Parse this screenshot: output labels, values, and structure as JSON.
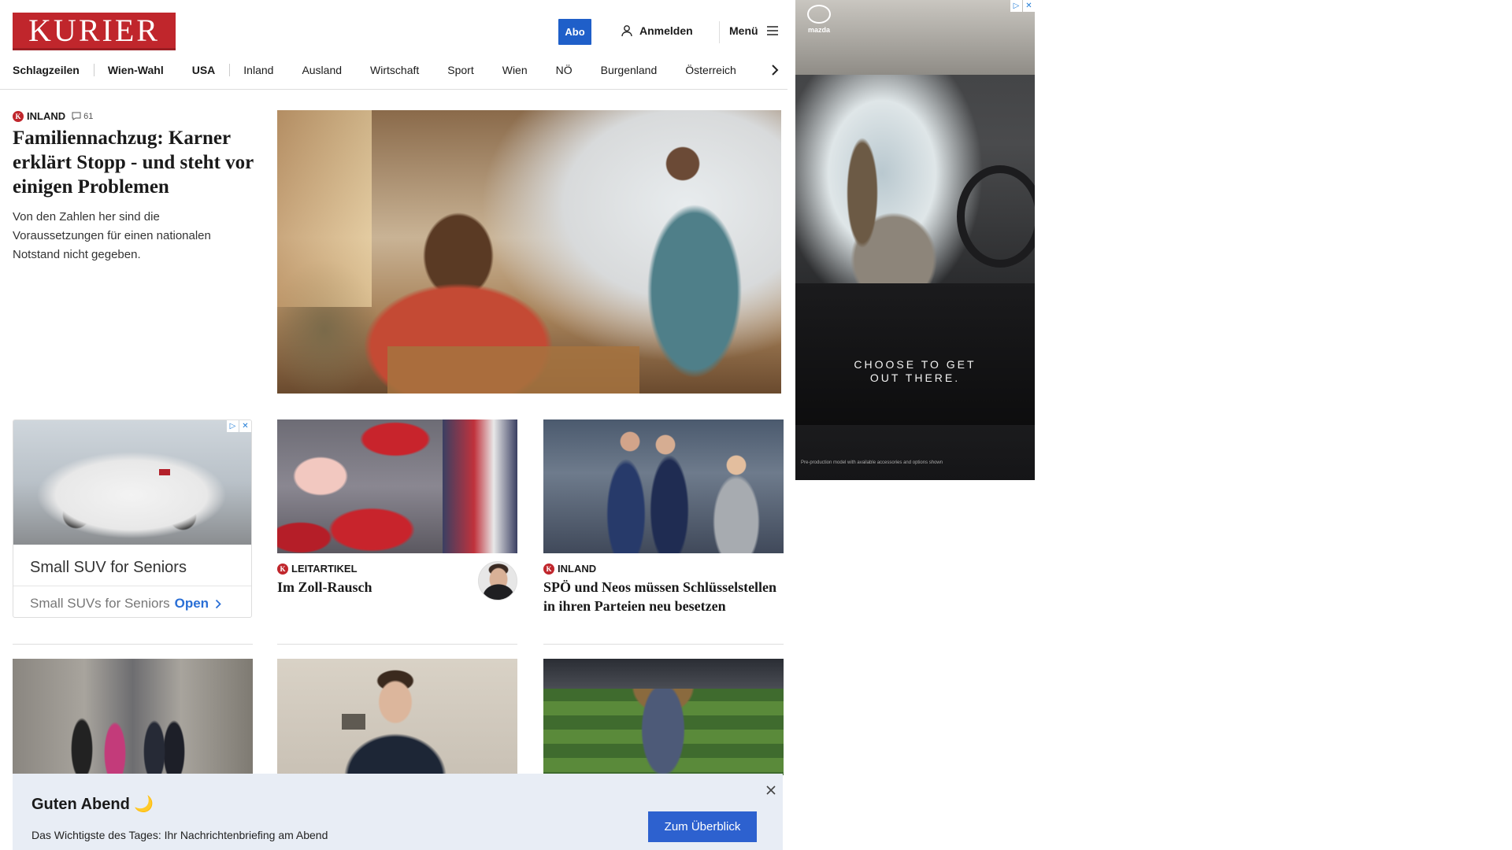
{
  "header": {
    "logo": "KURIER",
    "abo": "Abo",
    "login": "Anmelden",
    "menu": "Menü"
  },
  "nav": [
    {
      "label": "Schlagzeilen",
      "bold": true
    },
    {
      "label": "Wien-Wahl",
      "bold": true
    },
    {
      "label": "USA",
      "bold": true
    },
    {
      "label": "Inland",
      "bold": false
    },
    {
      "label": "Ausland",
      "bold": false
    },
    {
      "label": "Wirtschaft",
      "bold": false
    },
    {
      "label": "Sport",
      "bold": false
    },
    {
      "label": "Wien",
      "bold": false
    },
    {
      "label": "NÖ",
      "bold": false
    },
    {
      "label": "Burgenland",
      "bold": false
    },
    {
      "label": "Österreich",
      "bold": false
    }
  ],
  "lead": {
    "kicker": "INLAND",
    "comments": "61",
    "title": "Familiennachzug: Karner erklärt Stopp - und steht vor einigen Problemen",
    "teaser": "Von den Zahlen her sind die Voraussetzungen für einen nationalen Notstand nicht gegeben."
  },
  "ad_card": {
    "title": "Small SUV for Seniors",
    "subtitle": "Small SUVs for Seniors",
    "cta": "Open"
  },
  "articles": [
    {
      "kicker": "LEITARTIKEL",
      "title": "Im Zoll-Rausch"
    },
    {
      "kicker": "INLAND",
      "title": "SPÖ und Neos müssen Schlüsselstellen in ihren Parteien neu besetzen"
    }
  ],
  "side_ad": {
    "brand": "mazda",
    "tagline": "CHOOSE TO GET OUT THERE.",
    "fineprint": "Pre-production model with available accessories and options shown"
  },
  "banner": {
    "title": "Guten Abend 🌙",
    "text": "Das Wichtigste des Tages: Ihr Nachrichtenbriefing am Abend",
    "button": "Zum Überblick"
  },
  "colors": {
    "brand_red": "#c0262c",
    "accent_blue": "#1f5fc9",
    "banner_bg": "#e8edf5"
  }
}
